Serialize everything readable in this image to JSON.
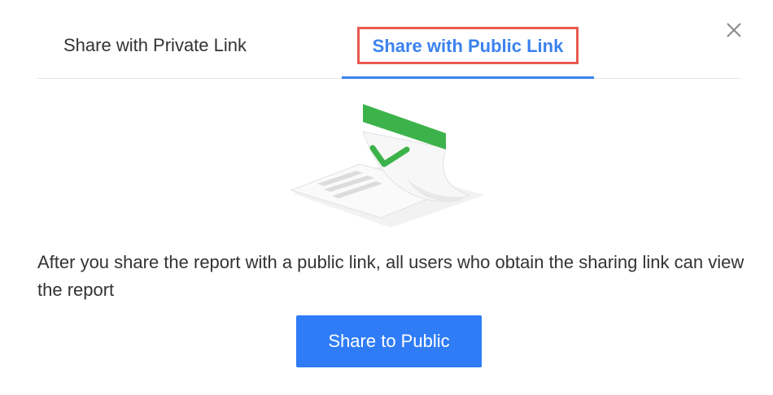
{
  "dialog": {
    "close_icon": "close-icon",
    "tabs": [
      {
        "label": "Share with Private Link",
        "active": false
      },
      {
        "label": "Share with Public Link",
        "active": true,
        "highlighted": true
      }
    ],
    "illustration_icon": "shared-document-check-icon",
    "description": "After you share the report with a public link, all users who obtain the sharing link can view the report",
    "share_button_label": "Share to Public"
  },
  "colors": {
    "accent": "#3b82f0",
    "button": "#2f7cf6",
    "highlight_border": "#e85a4f",
    "check_green": "#3cb34a"
  }
}
